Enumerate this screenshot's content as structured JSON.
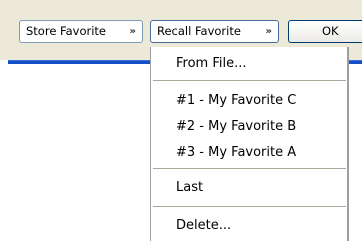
{
  "toolbar": {
    "store_favorite": "Store Favorite",
    "recall_favorite": "Recall Favorite",
    "ok": "OK",
    "caret_glyph": "»"
  },
  "menu": {
    "items": [
      {
        "label": "From File..."
      },
      {
        "label": "#1 - My Favorite C"
      },
      {
        "label": "#2 - My Favorite B"
      },
      {
        "label": "#3 - My Favorite A"
      },
      {
        "label": "Last"
      },
      {
        "label": "Delete..."
      }
    ]
  },
  "colors": {
    "toolbar_bg": "#ece9d8",
    "accent_rule": "#1450c8",
    "combo_border": "#7f9db9",
    "button_border": "#003c74"
  }
}
